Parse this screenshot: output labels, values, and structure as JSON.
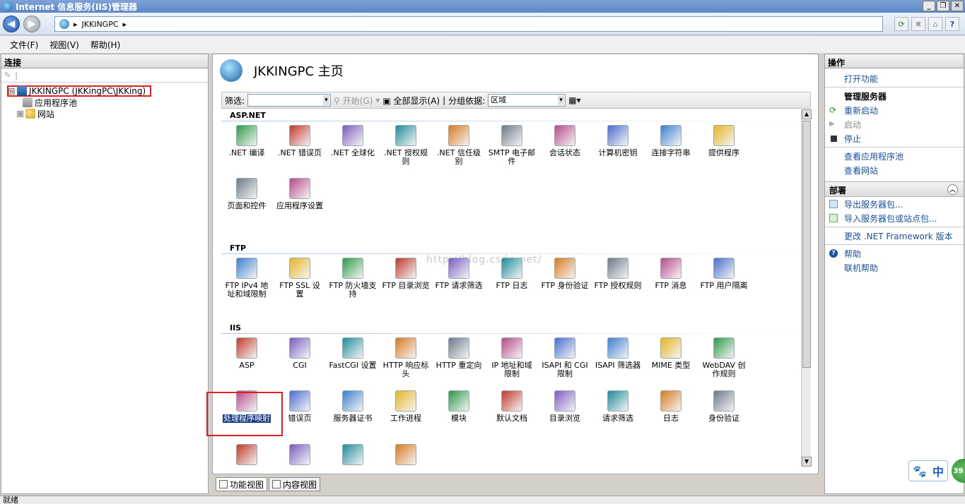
{
  "window": {
    "title": "Internet 信息服务(IIS)管理器",
    "buttons": [
      "_",
      "❐",
      "✕"
    ]
  },
  "nav": {
    "address": "JKKINGPC",
    "address_sep": "▸"
  },
  "menu": [
    "文件(F)",
    "视图(V)",
    "帮助(H)"
  ],
  "connections": {
    "header": "连接",
    "tree": [
      {
        "label": "JKKINGPC (JKKingPC\\JKKing)",
        "expander": "⊟",
        "icon": "server-icon"
      },
      {
        "label": "应用程序池",
        "expander": "",
        "icon": "app-pool-icon"
      },
      {
        "label": "网站",
        "expander": "⊞",
        "icon": "sites-folder-icon"
      }
    ]
  },
  "center": {
    "title": "JKKINGPC 主页",
    "filter_label": "筛选:",
    "go_label": "开始(G)",
    "show_all_label": "全部显示(A)",
    "group_label": "分组依据:",
    "group_value": "区域",
    "watermark": "http://blog.csdn.net/",
    "groups": [
      {
        "name": "ASP.NET"
      },
      {
        "name": "FTP"
      },
      {
        "name": "IIS"
      }
    ],
    "aspnet": [
      ".NET 编译",
      ".NET 错误页",
      ".NET 全球化",
      ".NET 授权规则",
      ".NET 信任级别",
      "SMTP 电子邮件",
      "会话状态",
      "计算机密钥",
      "连接字符串",
      "提供程序",
      "页面和控件",
      "应用程序设置"
    ],
    "ftp": [
      "FTP IPv4 地址和域限制",
      "FTP SSL 设置",
      "FTP 防火墙支持",
      "FTP 目录浏览",
      "FTP 请求筛选",
      "FTP 日志",
      "FTP 身份验证",
      "FTP 授权规则",
      "FTP 消息",
      "FTP 用户隔离"
    ],
    "iis_row1": [
      "ASP",
      "CGI",
      "FastCGI 设置",
      "HTTP 响应标头",
      "HTTP 重定向",
      "IP 地址和域限制",
      "ISAPI 和 CGI 限制",
      "ISAPI 筛选器",
      "MIME 类型",
      "WebDAV 创作规则"
    ],
    "iis_row2": [
      "处理程序映射",
      "错误页",
      "服务器证书",
      "工作进程",
      "模块",
      "默认文档",
      "目录浏览",
      "请求筛选",
      "日志",
      "身份验证"
    ],
    "selected_feature": "处理程序映射",
    "tabs": [
      "功能视图",
      "内容视图"
    ]
  },
  "actions": {
    "header": "操作",
    "open_feature": "打开功能",
    "manage_server_title": "管理服务器",
    "restart": "重新启动",
    "start": "启动",
    "stop": "停止",
    "view_app_pools": "查看应用程序池",
    "view_sites": "查看网站",
    "deploy_title": "部署",
    "export_pkg": "导出服务器包...",
    "import_pkg": "导入服务器包或站点包...",
    "change_framework": "更改 .NET Framework 版本",
    "help": "帮助",
    "online_help": "联机帮助"
  },
  "status": "就绪",
  "ime": {
    "label": "中",
    "badge": "39"
  },
  "colors": {
    "accent": "#1a4fa0",
    "selection": "#1a3e85",
    "highlight_box": "#e02020"
  }
}
